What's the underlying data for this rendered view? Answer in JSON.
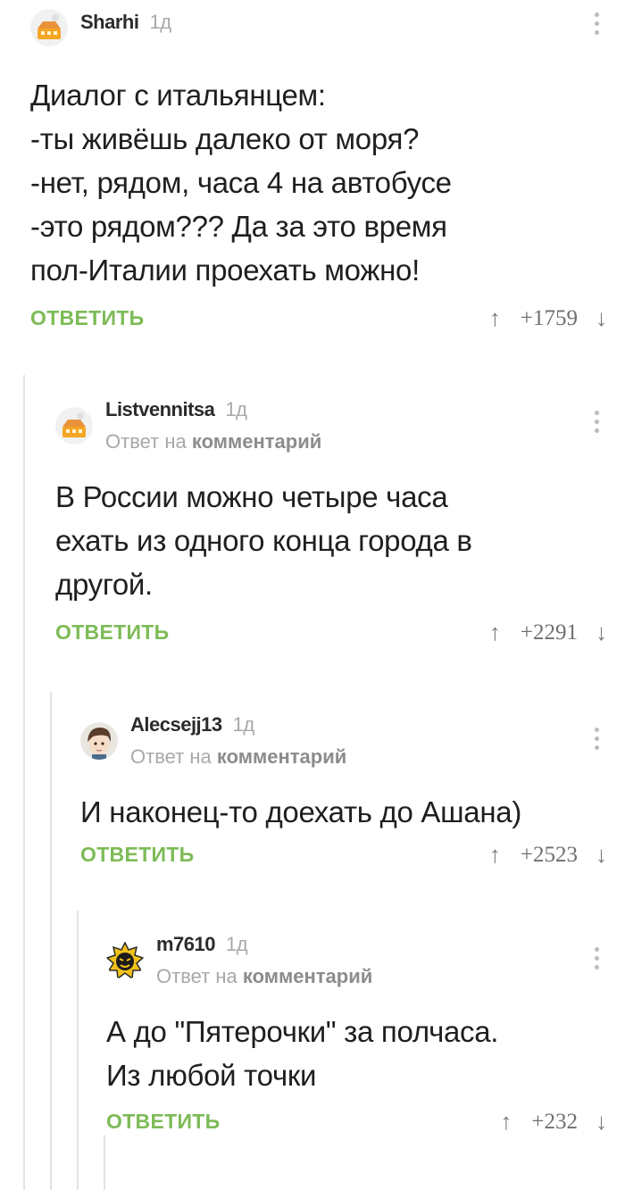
{
  "comments": [
    {
      "username": "Sharhi",
      "time": "1д",
      "avatar": "pikabu-default-avatar",
      "text": "Диалог с итальянцем:\n-ты живёшь далеко от моря?\n-нет, рядом, часа 4 на автобусе\n-это рядом??? Да за это время\nпол-Италии проехать можно!",
      "reply_label": "ОТВЕТИТЬ",
      "rating": "+1759"
    },
    {
      "username": "Listvennitsa",
      "time": "1д",
      "avatar": "pikabu-default-avatar",
      "reply_to_prefix": "Ответ на",
      "reply_to_link": "комментарий",
      "text": "В России  можно четыре часа\nехать из одного конца города в\nдругой.",
      "reply_label": "ОТВЕТИТЬ",
      "rating": "+2291"
    },
    {
      "username": "Alecsejj13",
      "time": "1д",
      "avatar": "anime-character-avatar",
      "reply_to_prefix": "Ответ на",
      "reply_to_link": "комментарий",
      "text": "И наконец-то доехать до Ашана)",
      "reply_label": "ОТВЕТИТЬ",
      "rating": "+2523"
    },
    {
      "username": "m7610",
      "time": "1д",
      "avatar": "bomb-face-avatar",
      "reply_to_prefix": "Ответ на",
      "reply_to_link": "комментарий",
      "text": "А до \"Пятерочки\" за полчаса.\nИз любой точки",
      "reply_label": "ОТВЕТИТЬ",
      "rating": "+232"
    }
  ],
  "icons": {
    "upvote": "↑",
    "downvote": "↓"
  },
  "colors": {
    "accent_green": "#7dbb57",
    "thread_line": "#e3e3e3",
    "muted_text": "#a8a8a8"
  }
}
